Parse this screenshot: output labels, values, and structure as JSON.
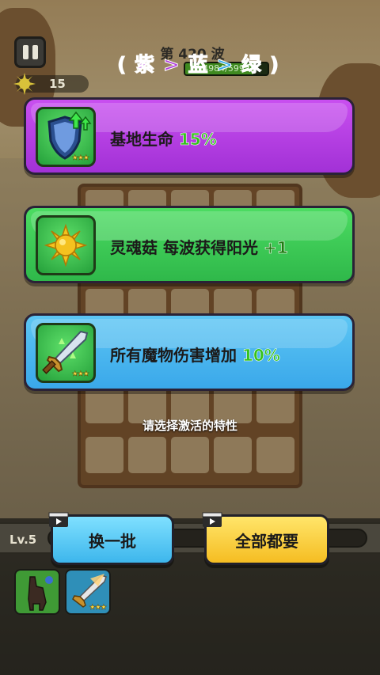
{
  "hud": {
    "sun_count": "15",
    "wave_label": "第 420 波",
    "wave_hp_text": "4984/5992",
    "wave_hp_fraction": 0.83
  },
  "order_hint": {
    "open": "(",
    "first": "紫",
    "arrow1": ">",
    "second": "蓝",
    "arrow2": ">",
    "third": "绿",
    "close": ")",
    "colors": {
      "purple": "#b13cdc",
      "blue": "#2fa9e8",
      "green": "#27b23d"
    }
  },
  "cards": [
    {
      "color": "purple",
      "icon": "shield-upgrade-icon",
      "name": "基地生命",
      "value": "15%",
      "value_color": "#34c21b",
      "stars": "★★★"
    },
    {
      "color": "green",
      "icon": "sun-icon",
      "name": "灵魂菇 每波获得阳光",
      "value": "+1",
      "value_color": "#1f7d12",
      "stars": ""
    },
    {
      "color": "blue",
      "icon": "sword-icon",
      "name": "所有魔物伤害增加",
      "value": "10%",
      "value_color": "#34c21b",
      "stars": "★★★"
    }
  ],
  "select_hint": "请选择激活的特性",
  "level": "Lv.5",
  "buttons": {
    "refresh": "换一批",
    "take_all": "全部都要"
  },
  "skill_slots": [
    {
      "icon": "alpaca-icon"
    },
    {
      "icon": "sword-icon",
      "stars": "★★★"
    }
  ]
}
